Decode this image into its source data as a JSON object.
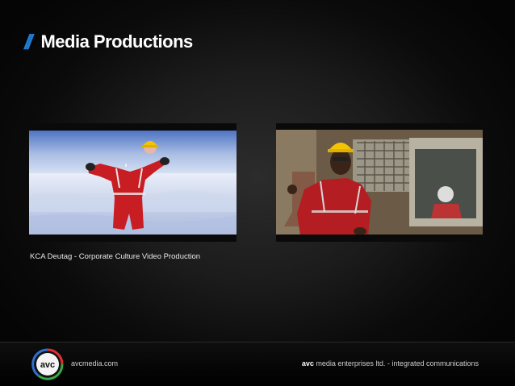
{
  "header": {
    "slashes": "//",
    "title": "Media Productions"
  },
  "caption": "KCA Deutag - Corporate Culture Video Production",
  "footer": {
    "logo_text": "avc",
    "website": "avcmedia.com",
    "company_brand": "avc",
    "company_rest": " media enterprises ltd.  -  integrated communications"
  },
  "colors": {
    "accent_blue": "#1f7fd6",
    "logo_red": "#e03030",
    "logo_green": "#3aa845",
    "logo_blue": "#2f6fd0"
  }
}
